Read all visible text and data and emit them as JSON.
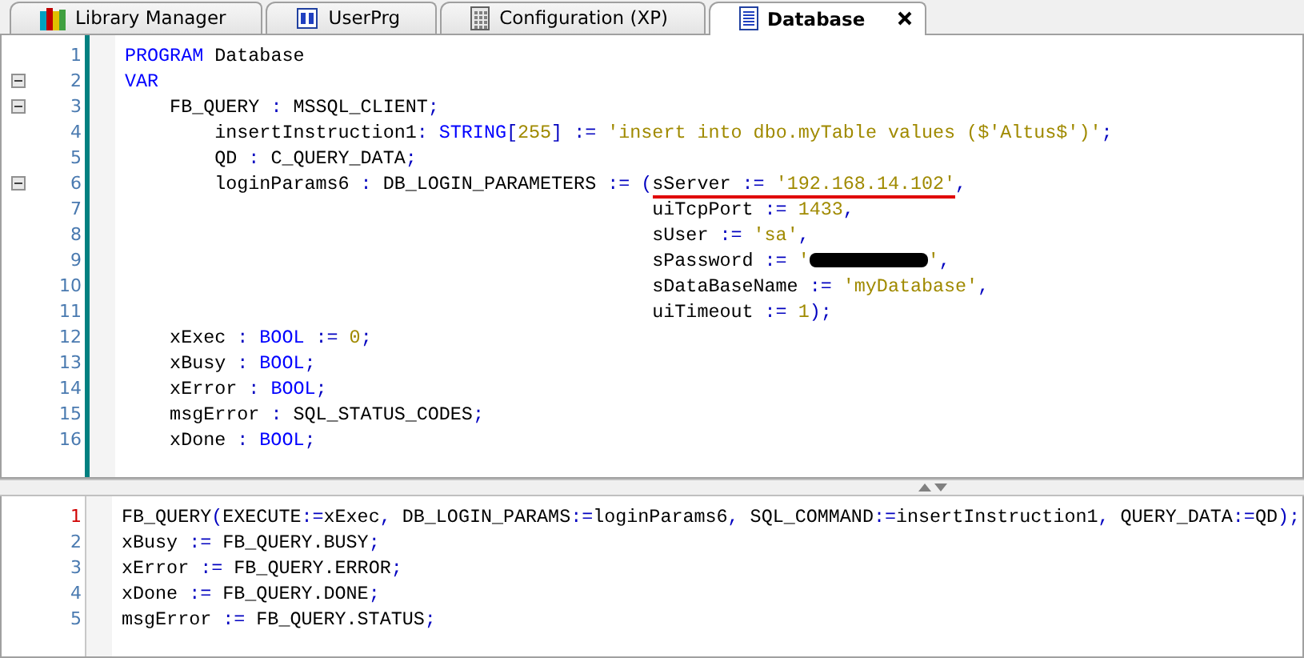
{
  "tabs": [
    {
      "label": "Library Manager",
      "selected": false,
      "closable": false
    },
    {
      "label": "UserPrg",
      "selected": false,
      "closable": false
    },
    {
      "label": "Configuration (XP)",
      "selected": false,
      "closable": false
    },
    {
      "label": "Database",
      "selected": true,
      "closable": true
    }
  ],
  "declarations": {
    "lines": [
      {
        "number": "1",
        "foldable": false,
        "tokens": [
          {
            "kind": "kw",
            "text": "PROGRAM"
          },
          {
            "kind": "id",
            "text": " Database"
          }
        ]
      },
      {
        "number": "2",
        "foldable": true,
        "tokens": [
          {
            "kind": "kw",
            "text": "VAR"
          }
        ]
      },
      {
        "number": "3",
        "foldable": true,
        "tokens": [
          {
            "kind": "id",
            "text": "    FB_QUERY "
          },
          {
            "kind": "op",
            "text": ": "
          },
          {
            "kind": "id",
            "text": "MSSQL_CLIENT"
          },
          {
            "kind": "op",
            "text": ";"
          }
        ]
      },
      {
        "number": "4",
        "foldable": false,
        "tokens": [
          {
            "kind": "id",
            "text": "        insertInstruction1"
          },
          {
            "kind": "op",
            "text": ": "
          },
          {
            "kind": "kw",
            "text": "STRING"
          },
          {
            "kind": "op",
            "text": "["
          },
          {
            "kind": "num",
            "text": "255"
          },
          {
            "kind": "op",
            "text": "] := "
          },
          {
            "kind": "str",
            "text": "'insert into dbo.myTable values ($'Altus$')'"
          },
          {
            "kind": "op",
            "text": ";"
          }
        ]
      },
      {
        "number": "5",
        "foldable": false,
        "tokens": [
          {
            "kind": "id",
            "text": "        QD "
          },
          {
            "kind": "op",
            "text": ": "
          },
          {
            "kind": "id",
            "text": "C_QUERY_DATA"
          },
          {
            "kind": "op",
            "text": ";"
          }
        ]
      },
      {
        "number": "6",
        "foldable": true,
        "tokens": [
          {
            "kind": "id",
            "text": "        loginParams6 "
          },
          {
            "kind": "op",
            "text": ": "
          },
          {
            "kind": "id",
            "text": "DB_LOGIN_PARAMETERS "
          },
          {
            "kind": "op",
            "text": ":= ("
          },
          {
            "kind": "id",
            "text": "sServer ",
            "underlined": true
          },
          {
            "kind": "op",
            "text": ":= ",
            "underlined": true
          },
          {
            "kind": "str",
            "text": "'192.168.14.102'",
            "underlined": true
          },
          {
            "kind": "op",
            "text": ","
          }
        ]
      },
      {
        "number": "7",
        "foldable": false,
        "tokens": [
          {
            "kind": "id",
            "text": "                                               uiTcpPort "
          },
          {
            "kind": "op",
            "text": ":= "
          },
          {
            "kind": "num",
            "text": "1433"
          },
          {
            "kind": "op",
            "text": ","
          }
        ]
      },
      {
        "number": "8",
        "foldable": false,
        "tokens": [
          {
            "kind": "id",
            "text": "                                               sUser "
          },
          {
            "kind": "op",
            "text": ":= "
          },
          {
            "kind": "str",
            "text": "'sa'"
          },
          {
            "kind": "op",
            "text": ","
          }
        ]
      },
      {
        "number": "9",
        "foldable": false,
        "tokens": [
          {
            "kind": "id",
            "text": "                                               sPassword "
          },
          {
            "kind": "op",
            "text": ":= "
          },
          {
            "kind": "str",
            "text": "'"
          },
          {
            "kind": "redacted"
          },
          {
            "kind": "str",
            "text": "'"
          },
          {
            "kind": "op",
            "text": ","
          }
        ]
      },
      {
        "number": "10",
        "foldable": false,
        "tokens": [
          {
            "kind": "id",
            "text": "                                               sDataBaseName "
          },
          {
            "kind": "op",
            "text": ":= "
          },
          {
            "kind": "str",
            "text": "'myDatabase'"
          },
          {
            "kind": "op",
            "text": ","
          }
        ]
      },
      {
        "number": "11",
        "foldable": false,
        "tokens": [
          {
            "kind": "id",
            "text": "                                               uiTimeout "
          },
          {
            "kind": "op",
            "text": ":= "
          },
          {
            "kind": "num",
            "text": "1"
          },
          {
            "kind": "op",
            "text": ");"
          }
        ]
      },
      {
        "number": "12",
        "foldable": false,
        "tokens": [
          {
            "kind": "id",
            "text": "    xExec "
          },
          {
            "kind": "op",
            "text": ": "
          },
          {
            "kind": "kw",
            "text": "BOOL"
          },
          {
            "kind": "op",
            "text": " := "
          },
          {
            "kind": "num",
            "text": "0"
          },
          {
            "kind": "op",
            "text": ";"
          }
        ]
      },
      {
        "number": "13",
        "foldable": false,
        "tokens": [
          {
            "kind": "id",
            "text": "    xBusy "
          },
          {
            "kind": "op",
            "text": ": "
          },
          {
            "kind": "kw",
            "text": "BOOL"
          },
          {
            "kind": "op",
            "text": ";"
          }
        ]
      },
      {
        "number": "14",
        "foldable": false,
        "tokens": [
          {
            "kind": "id",
            "text": "    xError "
          },
          {
            "kind": "op",
            "text": ": "
          },
          {
            "kind": "kw",
            "text": "BOOL"
          },
          {
            "kind": "op",
            "text": ";"
          }
        ]
      },
      {
        "number": "15",
        "foldable": false,
        "tokens": [
          {
            "kind": "id",
            "text": "    msgError "
          },
          {
            "kind": "op",
            "text": ": "
          },
          {
            "kind": "id",
            "text": "SQL_STATUS_CODES"
          },
          {
            "kind": "op",
            "text": ";"
          }
        ]
      },
      {
        "number": "16",
        "foldable": false,
        "tokens": [
          {
            "kind": "id",
            "text": "    xDone "
          },
          {
            "kind": "op",
            "text": ": "
          },
          {
            "kind": "kw",
            "text": "BOOL"
          },
          {
            "kind": "op",
            "text": ";"
          }
        ]
      }
    ]
  },
  "implementation": {
    "lines": [
      {
        "number": "1",
        "marked": true,
        "tokens": [
          {
            "kind": "id",
            "text": "FB_QUERY"
          },
          {
            "kind": "op",
            "text": "("
          },
          {
            "kind": "id",
            "text": "EXECUTE"
          },
          {
            "kind": "op",
            "text": ":="
          },
          {
            "kind": "id",
            "text": "xExec"
          },
          {
            "kind": "op",
            "text": ","
          },
          {
            "kind": "id",
            "text": " DB_LOGIN_PARAMS"
          },
          {
            "kind": "op",
            "text": ":="
          },
          {
            "kind": "id",
            "text": "loginParams6"
          },
          {
            "kind": "op",
            "text": ","
          },
          {
            "kind": "id",
            "text": " SQL_COMMAND"
          },
          {
            "kind": "op",
            "text": ":="
          },
          {
            "kind": "id",
            "text": "insertInstruction1"
          },
          {
            "kind": "op",
            "text": ","
          },
          {
            "kind": "id",
            "text": " QUERY_DATA"
          },
          {
            "kind": "op",
            "text": ":="
          },
          {
            "kind": "id",
            "text": "QD"
          },
          {
            "kind": "op",
            "text": ");"
          }
        ]
      },
      {
        "number": "2",
        "marked": false,
        "tokens": [
          {
            "kind": "id",
            "text": "xBusy "
          },
          {
            "kind": "op",
            "text": ":= "
          },
          {
            "kind": "id",
            "text": "FB_QUERY.BUSY"
          },
          {
            "kind": "op",
            "text": ";"
          }
        ]
      },
      {
        "number": "3",
        "marked": false,
        "tokens": [
          {
            "kind": "id",
            "text": "xError "
          },
          {
            "kind": "op",
            "text": ":= "
          },
          {
            "kind": "id",
            "text": "FB_QUERY.ERROR"
          },
          {
            "kind": "op",
            "text": ";"
          }
        ]
      },
      {
        "number": "4",
        "marked": false,
        "tokens": [
          {
            "kind": "id",
            "text": "xDone "
          },
          {
            "kind": "op",
            "text": ":= "
          },
          {
            "kind": "id",
            "text": "FB_QUERY.DONE"
          },
          {
            "kind": "op",
            "text": ";"
          }
        ]
      },
      {
        "number": "5",
        "marked": false,
        "tokens": [
          {
            "kind": "id",
            "text": "msgError "
          },
          {
            "kind": "op",
            "text": ":= "
          },
          {
            "kind": "id",
            "text": "FB_QUERY.STATUS"
          },
          {
            "kind": "op",
            "text": ";"
          }
        ]
      }
    ]
  }
}
